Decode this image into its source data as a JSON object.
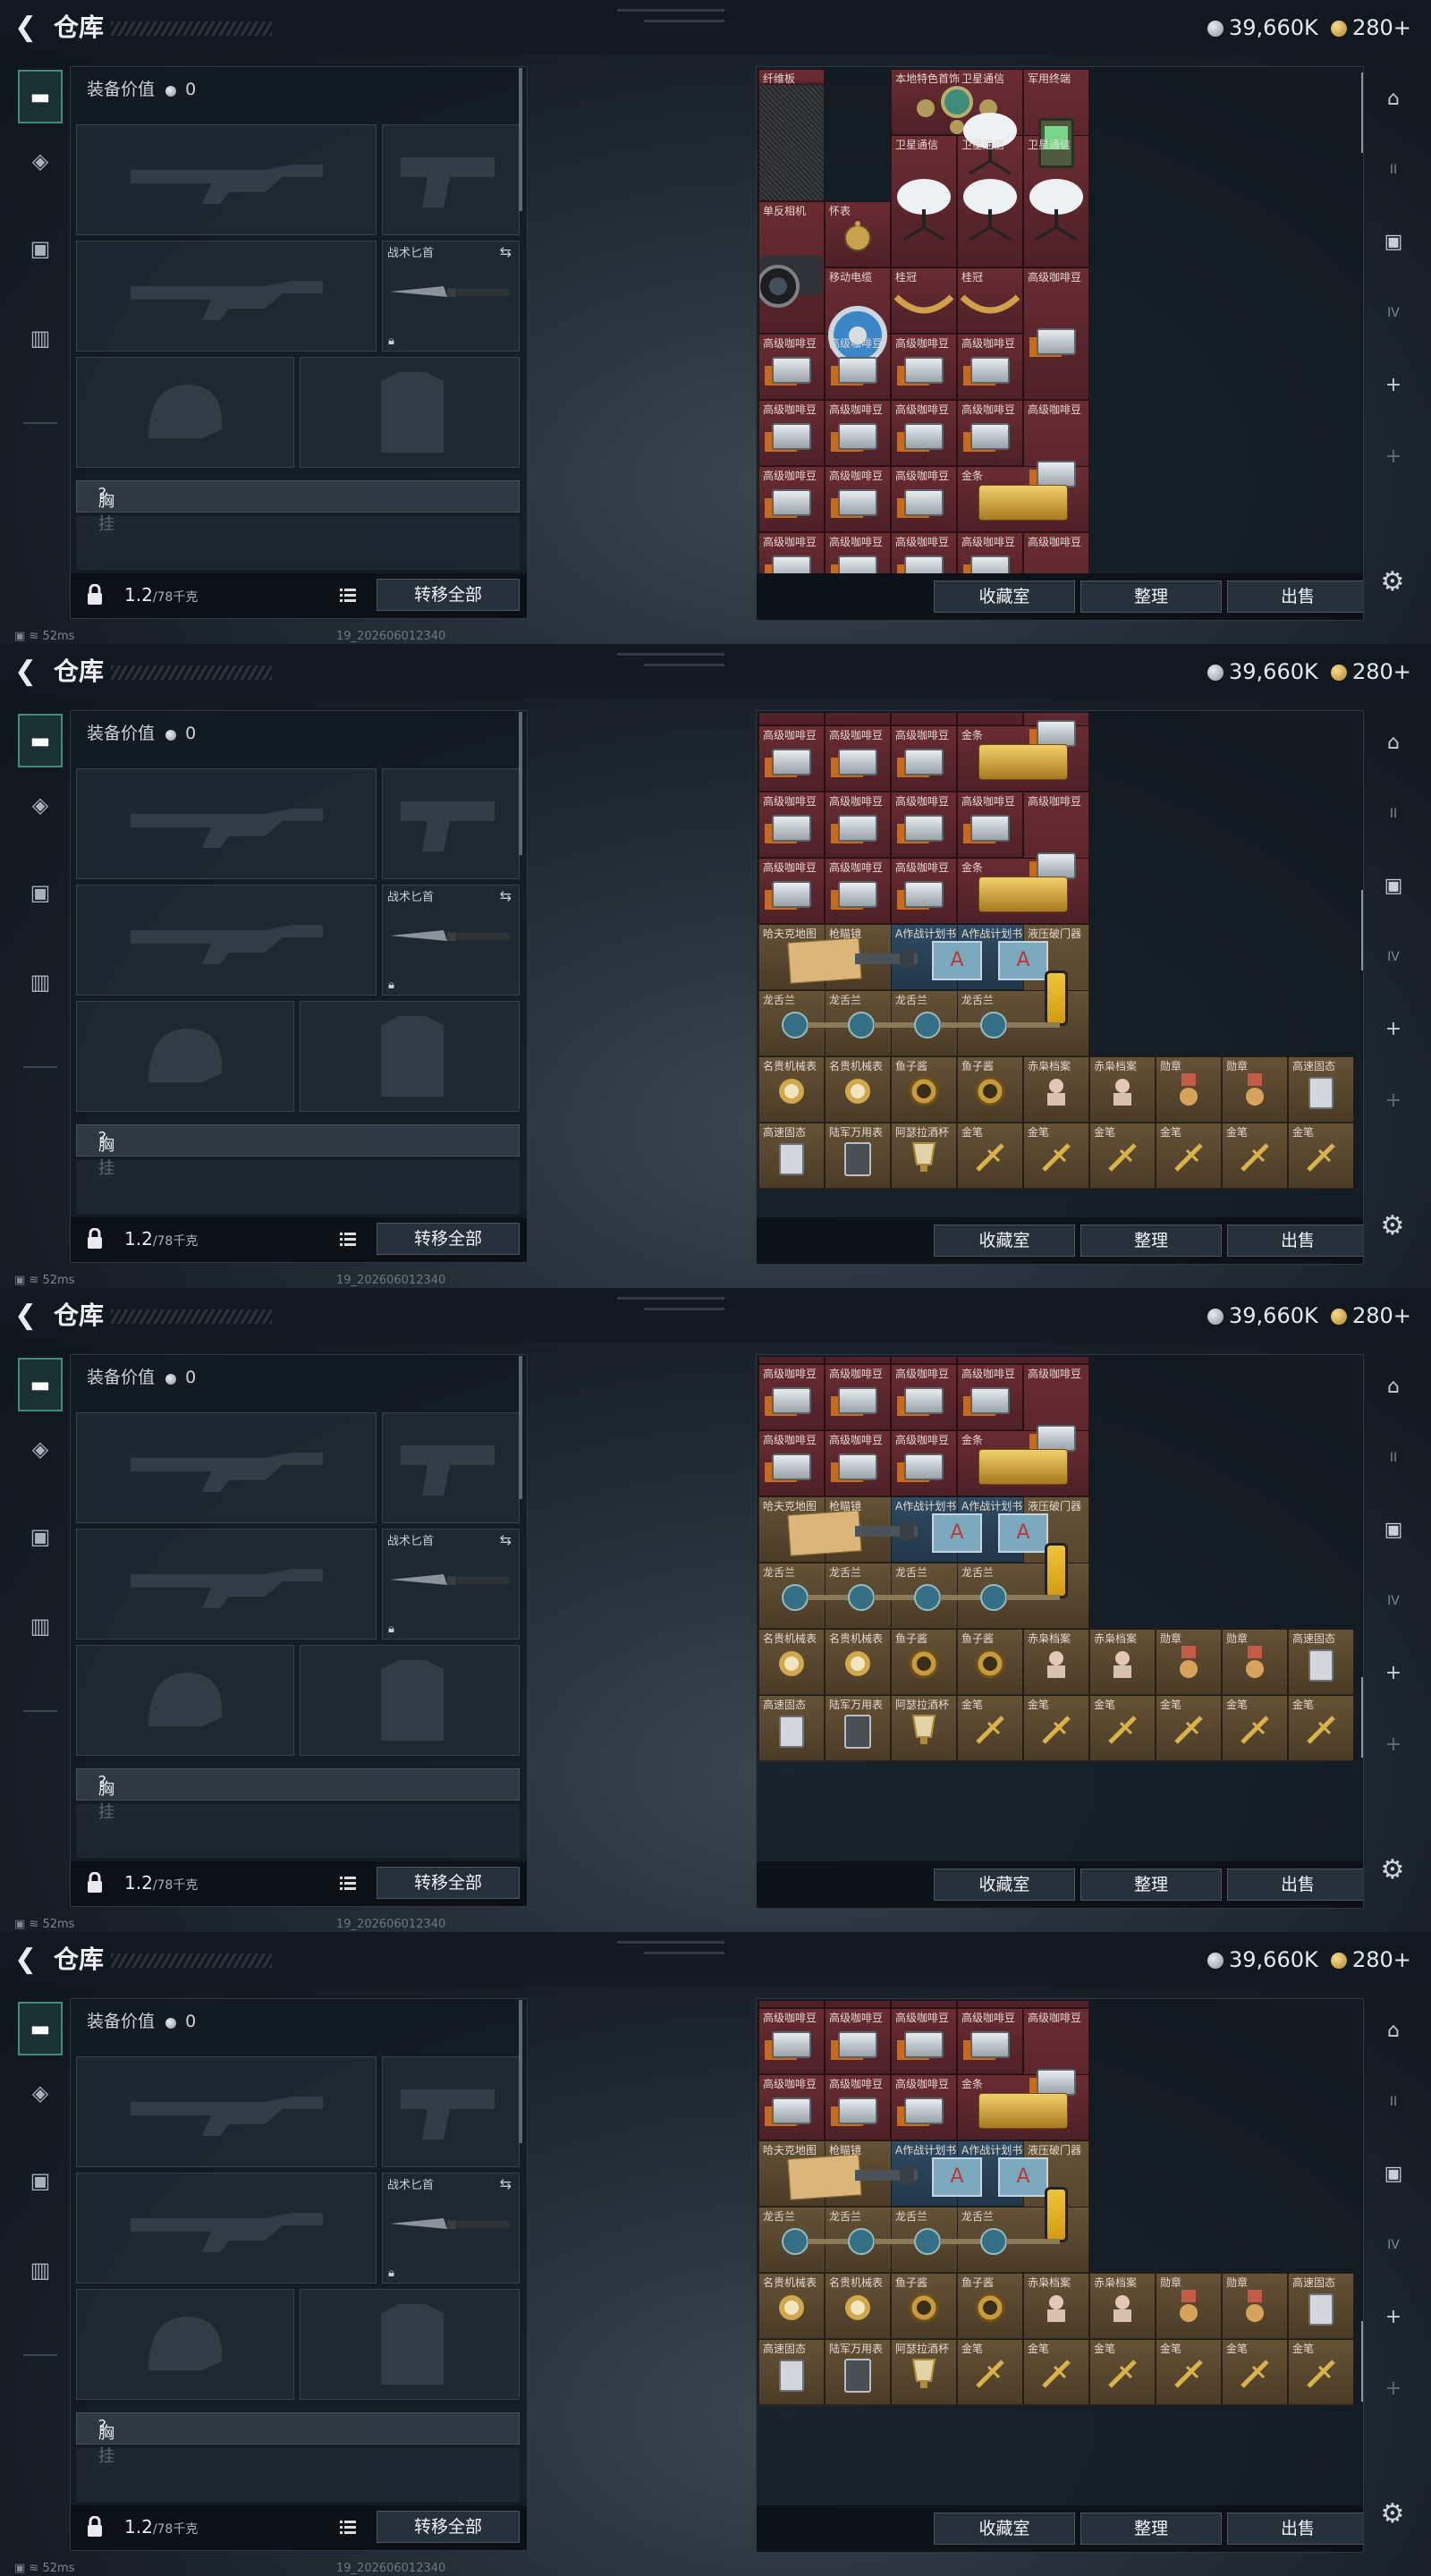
{
  "header": {
    "back_icon": "chevron-left-icon",
    "title": "仓库",
    "silver_currency": "39,660K",
    "gold_currency": "280+"
  },
  "sidebar": {
    "tabs": [
      {
        "icon": "pistol-icon",
        "active": true
      },
      {
        "icon": "armor-icon",
        "active": false
      },
      {
        "icon": "backpack-icon",
        "active": false
      },
      {
        "icon": "briefcase-icon",
        "active": false
      }
    ]
  },
  "loadout": {
    "equip_value_label": "装备价值",
    "equip_value": "0",
    "knife_slot_name": "战术匕首",
    "chest_rig_label": "胸挂",
    "weight_current": "1.2",
    "weight_max": "/78千克",
    "transfer_all_label": "转移全部"
  },
  "stash": {
    "buttons": [
      "收藏室",
      "整理",
      "出售"
    ],
    "item_names": {
      "fiberboard": "纤维板",
      "local_jewelry": "本地特色首饰",
      "satellite": "卫星通信",
      "military_terminal": "军用终端",
      "camera": "单反相机",
      "pocket_watch": "怀表",
      "reel": "移动电缆",
      "chain": "桂冠",
      "coffee": "高级咖啡豆",
      "gold": "金条",
      "map": "哈夫克地图",
      "scope": "枪瞄镜",
      "plan": "A作战计划书",
      "breaker": "液压破门器",
      "dragon": "龙舌兰",
      "watch": "名贵机械表",
      "fish_eye": "鱼子酱",
      "file": "赤枭档案",
      "medal": "勋章",
      "drive": "高速固态",
      "safe": "陆军万用表",
      "cup": "阿瑟拉酒杯",
      "pen": "金笔"
    }
  },
  "footer": {
    "ping": "52ms",
    "build": "19_202606012340"
  },
  "colors": {
    "accent_green": "#3e8d78",
    "red_rarity": "#6a2c33",
    "gold_rarity": "#655236",
    "purple_rarity": "#493b5e",
    "blue_rarity": "#2f4c64"
  }
}
